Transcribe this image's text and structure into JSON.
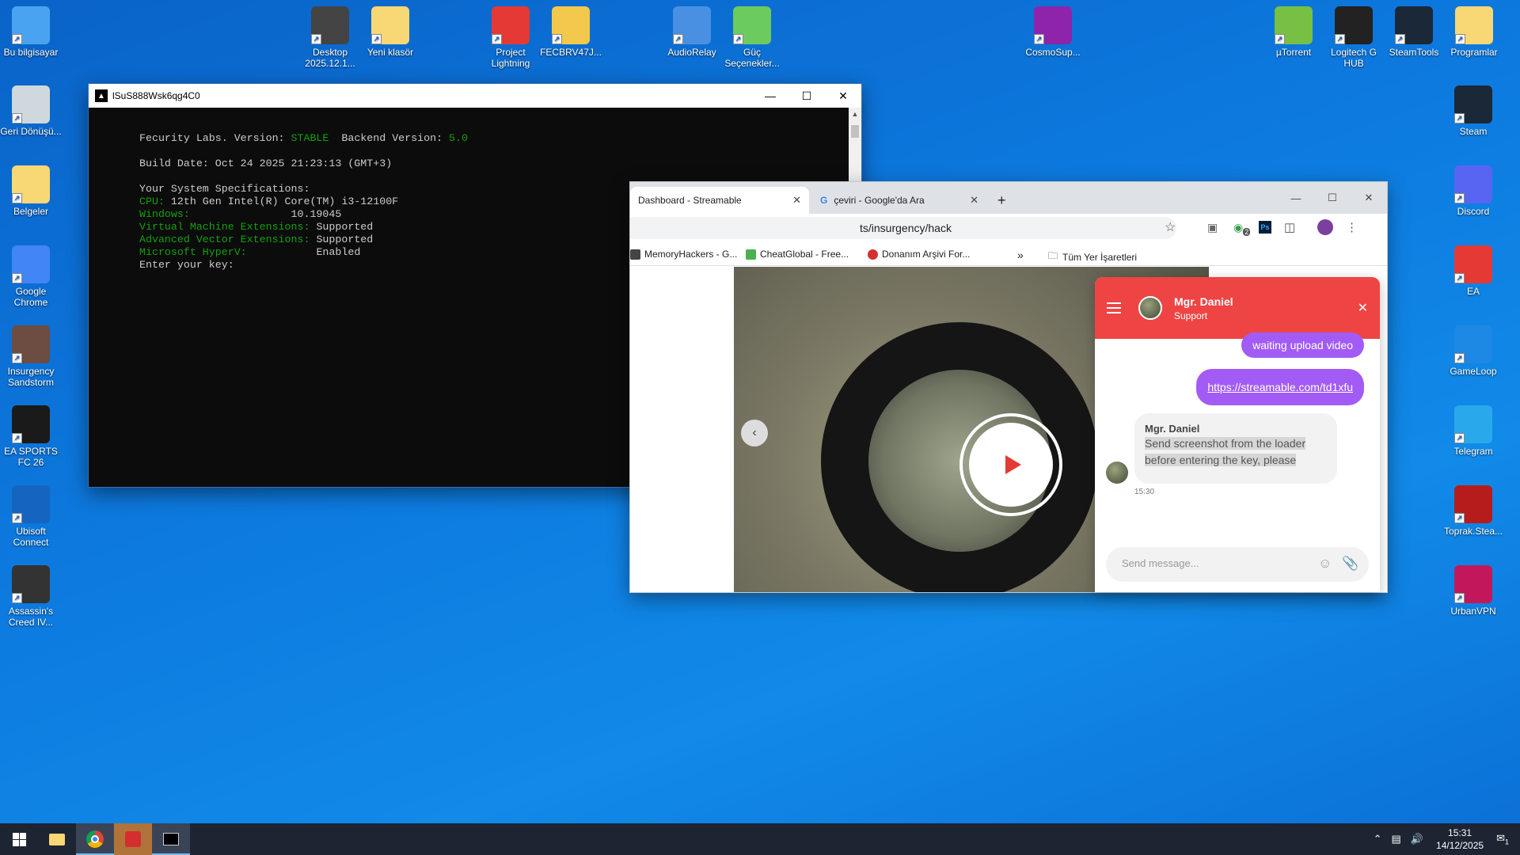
{
  "desktop": {
    "top_icons": [
      {
        "label": "Bu bilgisayar",
        "icon": "computer-icon",
        "color": "#4aa3f0"
      },
      {
        "label": "Desktop 2025.12.1...",
        "icon": "video-file-icon",
        "color": "#444444"
      },
      {
        "label": "Yeni klasör",
        "icon": "folder-icon",
        "color": "#f8d775"
      },
      {
        "label": "Project Lightning",
        "icon": "lightning-icon",
        "color": "#e53935"
      },
      {
        "label": "FECBRV47J...",
        "icon": "file-icon",
        "color": "#f2c94c"
      },
      {
        "label": "AudioRelay",
        "icon": "audio-relay-icon",
        "color": "#4a90e2"
      },
      {
        "label": "Güç Seçenekler...",
        "icon": "battery-icon",
        "color": "#6ccb5f"
      },
      {
        "label": "CosmoSup...",
        "icon": "cosmo-icon",
        "color": "#8e24aa"
      },
      {
        "label": "µTorrent",
        "icon": "utorrent-icon",
        "color": "#78c043"
      },
      {
        "label": "Logitech G HUB",
        "icon": "logitech-icon",
        "color": "#222222"
      },
      {
        "label": "SteamTools",
        "icon": "steamtools-icon",
        "color": "#1b2838"
      },
      {
        "label": "Programlar",
        "icon": "folder-icon",
        "color": "#f8d775"
      }
    ],
    "left_icons": [
      {
        "label": "Geri Dönüşü...",
        "icon": "recycle-bin-icon",
        "color": "#cfd8dc"
      },
      {
        "label": "Belgeler",
        "icon": "documents-icon",
        "color": "#f8d775"
      },
      {
        "label": "Google Chrome",
        "icon": "chrome-icon",
        "color": "#4285f4"
      },
      {
        "label": "Insurgency Sandstorm",
        "icon": "game-icon",
        "color": "#6d4c41"
      },
      {
        "label": "EA SPORTS FC 26",
        "icon": "fc26-icon",
        "color": "#1a1a1a"
      },
      {
        "label": "Ubisoft Connect",
        "icon": "ubisoft-icon",
        "color": "#1565c0"
      },
      {
        "label": "Assassin's Creed IV...",
        "icon": "game-icon",
        "color": "#333333"
      }
    ],
    "right_icons": [
      {
        "label": "Steam",
        "icon": "steam-icon",
        "color": "#1b2838"
      },
      {
        "label": "Discord",
        "icon": "discord-icon",
        "color": "#5865f2"
      },
      {
        "label": "EA",
        "icon": "ea-icon",
        "color": "#e53935"
      },
      {
        "label": "GameLoop",
        "icon": "gameloop-icon",
        "color": "#1e88e5"
      },
      {
        "label": "Telegram",
        "icon": "telegram-icon",
        "color": "#29a9eb"
      },
      {
        "label": "Toprak.Stea...",
        "icon": "steam-icon",
        "color": "#b71c1c"
      },
      {
        "label": "UrbanVPN",
        "icon": "vpn-icon",
        "color": "#c2185b"
      }
    ]
  },
  "console": {
    "title": "lSuS888Wsk6qg4C0",
    "lines": {
      "l1a": "Fecurity Labs. Version: ",
      "l1b": "STABLE",
      "l1c": "  Backend Version: ",
      "l1d": "5.0",
      "l2": "Build Date: Oct 24 2025 21:23:13 (GMT+3)",
      "l3": "Your System Specifications:",
      "cpu_k": "CPU: ",
      "cpu_v": "12th Gen Intel(R) Core(TM) i3-12100F",
      "win_k": "Windows:                ",
      "win_v": "10.19045",
      "vme_k": "Virtual Machine Extensions: ",
      "vme_v": "Supported",
      "ave_k": "Advanced Vector Extensions: ",
      "ave_v": "Supported",
      "hv_k": "Microsoft HyperV:           ",
      "hv_v": "Enabled",
      "prompt": "Enter your key:"
    }
  },
  "browser": {
    "tabs": [
      {
        "label": "Dashboard - Streamable"
      },
      {
        "label": "çeviri - Google'da Ara"
      }
    ],
    "url": "ts/insurgency/hack",
    "bookmarks": [
      "MemoryHackers - G...",
      "CheatGlobal - Free...",
      "Donanım Arşivi For...",
      "Tüm Yer İşaretleri"
    ],
    "extension_badge": "2"
  },
  "chat": {
    "agent_name": "Mgr. Daniel",
    "agent_role": "Support",
    "out_messages": [
      "waiting upload video",
      "https://streamable.com/td1xfu"
    ],
    "in_name": "Mgr. Daniel",
    "in_line1": "Send screenshot from the loader",
    "in_line2": "before entering the key, please",
    "time": "15:30",
    "input_placeholder": "Send message..."
  },
  "taskbar": {
    "clock_time": "15:31",
    "clock_date": "14/12/2025",
    "notification_count": "1"
  }
}
